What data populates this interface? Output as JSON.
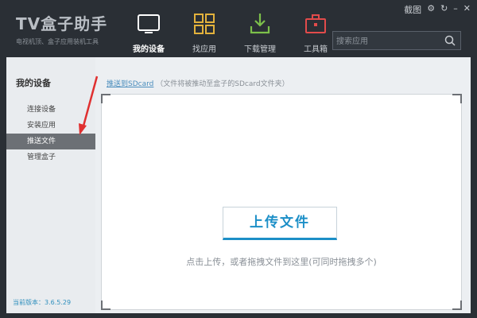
{
  "app": {
    "title": "TV盒子助手",
    "subtitle": "电视机顶、盒子应用装机工具"
  },
  "nav": [
    {
      "label": "我的设备",
      "icon": "tv-icon",
      "active": true
    },
    {
      "label": "找应用",
      "icon": "apps-grid-icon",
      "active": false
    },
    {
      "label": "下载管理",
      "icon": "download-icon",
      "active": false
    },
    {
      "label": "工具箱",
      "icon": "toolbox-icon",
      "active": false
    }
  ],
  "window_controls": {
    "screenshot_label": "截图",
    "settings_icon": "gear-icon",
    "refresh_icon": "refresh-icon",
    "minimize_icon": "minimize-icon",
    "close_icon": "close-icon"
  },
  "search": {
    "placeholder": "搜索应用",
    "icon": "search-icon"
  },
  "sidebar": {
    "heading": "我的设备",
    "items": [
      {
        "label": "连接设备",
        "active": false
      },
      {
        "label": "安装应用",
        "active": false
      },
      {
        "label": "推送文件",
        "active": true
      },
      {
        "label": "管理盒子",
        "active": false
      }
    ],
    "version_label": "当前版本：3.6.5.29"
  },
  "main": {
    "crumb_link": "推送到SDcard",
    "crumb_hint": "（文件将被推动至盒子的SDcard文件夹）",
    "upload_button": "上传文件",
    "drop_hint": "点击上传，或者拖拽文件到这里(可同时拖拽多个)"
  },
  "colors": {
    "accent": "#1c8fc7",
    "header_bg": "#2a2f35",
    "annotation": "#e03030"
  }
}
